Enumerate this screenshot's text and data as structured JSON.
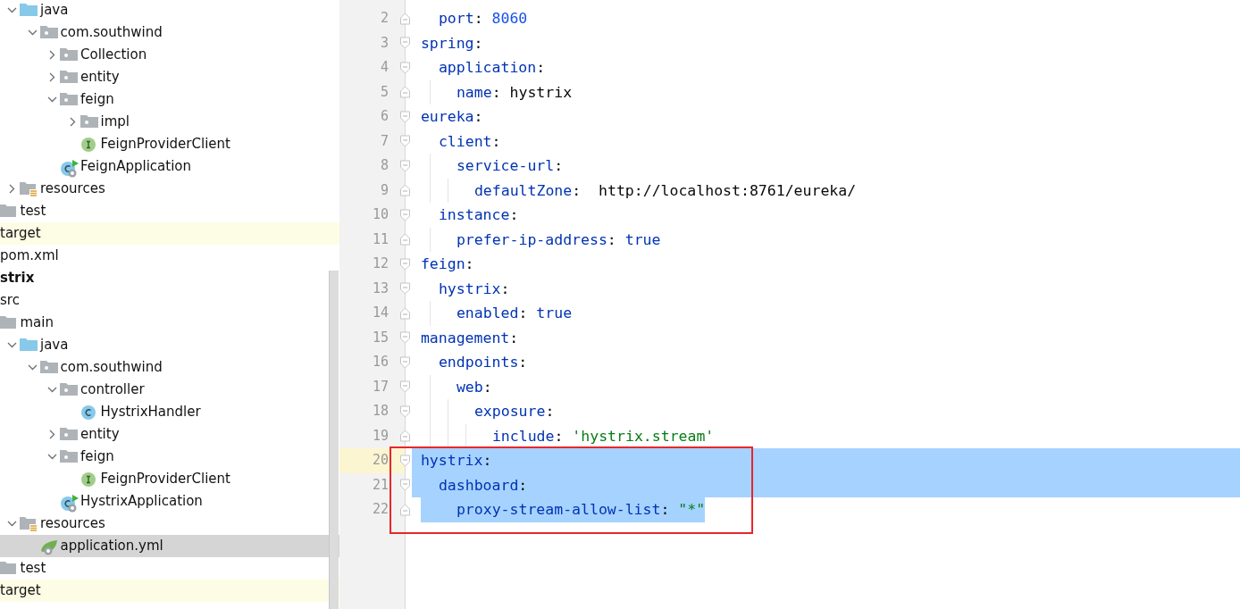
{
  "project_tree": [
    {
      "children": [
        {
          "children": [
            {
              "children": [
                {
                  "label": "java",
                  "kind": "source_root",
                  "expanded": true,
                  "selected": false,
                  "children": [
                    {
                      "label": "com.southwind",
                      "kind": "package",
                      "expanded": true,
                      "selected": false,
                      "children": [
                        {
                          "label": "Collection",
                          "kind": "package",
                          "expanded": false,
                          "selected": false
                        },
                        {
                          "label": "entity",
                          "kind": "package",
                          "expanded": false,
                          "selected": false
                        },
                        {
                          "label": "feign",
                          "kind": "package",
                          "expanded": true,
                          "selected": false,
                          "children": [
                            {
                              "label": "impl",
                              "kind": "package",
                              "expanded": false,
                              "selected": false
                            },
                            {
                              "label": "FeignProviderClient",
                              "kind": "interface",
                              "selected": false
                            }
                          ]
                        },
                        {
                          "label": "FeignApplication",
                          "kind": "app_class",
                          "selected": false
                        }
                      ]
                    }
                  ]
                },
                {
                  "label": "resources",
                  "kind": "resources",
                  "expanded": false,
                  "selected": false
                }
              ]
            },
            {
              "label": "test",
              "kind": "folder",
              "selected": false
            }
          ]
        },
        {
          "label": "target",
          "kind": "excluded",
          "selected": false
        },
        {
          "label": "pom.xml",
          "kind": "file",
          "selected": false
        }
      ]
    },
    {
      "label": "strix",
      "kind": "module",
      "selected": false,
      "children": [
        {
          "label": "src",
          "kind": "folder",
          "selected": false,
          "children": [
            {
              "label": "main",
              "kind": "folder",
              "selected": false,
              "children": [
                {
                  "label": "java",
                  "kind": "source_root",
                  "expanded": true,
                  "selected": false,
                  "children": [
                    {
                      "label": "com.southwind",
                      "kind": "package",
                      "expanded": true,
                      "selected": false,
                      "children": [
                        {
                          "label": "controller",
                          "kind": "package",
                          "expanded": true,
                          "selected": false,
                          "children": [
                            {
                              "label": "HystrixHandler",
                              "kind": "class",
                              "selected": false
                            }
                          ]
                        },
                        {
                          "label": "entity",
                          "kind": "package",
                          "expanded": false,
                          "selected": false
                        },
                        {
                          "label": "feign",
                          "kind": "package",
                          "expanded": true,
                          "selected": false,
                          "children": [
                            {
                              "label": "FeignProviderClient",
                              "kind": "interface",
                              "selected": false
                            }
                          ]
                        },
                        {
                          "label": "HystrixApplication",
                          "kind": "app_class",
                          "selected": false
                        }
                      ]
                    }
                  ]
                },
                {
                  "label": "resources",
                  "kind": "resources",
                  "expanded": true,
                  "selected": false,
                  "children": [
                    {
                      "label": "application.yml",
                      "kind": "yml",
                      "selected": true
                    }
                  ]
                }
              ]
            },
            {
              "label": "test",
              "kind": "folder",
              "selected": false
            }
          ]
        },
        {
          "label": "target",
          "kind": "excluded",
          "selected": false
        }
      ]
    }
  ],
  "editor": {
    "lines": [
      {
        "children": [
          {
            "number": "2",
            "selected": false,
            "current": false,
            "tokens": [
              {
                "kind": "key",
                "text": "port"
              },
              {
                "kind": "punct",
                "text": ": "
              },
              {
                "kind": "number",
                "text": "8060"
              }
            ]
          }
        ]
      },
      {
        "number": "3",
        "selected": false,
        "current": false,
        "tokens": [
          {
            "kind": "key",
            "text": "spring"
          },
          {
            "kind": "punct",
            "text": ":"
          }
        ],
        "children": [
          {
            "number": "4",
            "selected": false,
            "current": false,
            "tokens": [
              {
                "kind": "key",
                "text": "application"
              },
              {
                "kind": "punct",
                "text": ":"
              }
            ],
            "children": [
              {
                "number": "5",
                "selected": false,
                "current": false,
                "tokens": [
                  {
                    "kind": "key",
                    "text": "name"
                  },
                  {
                    "kind": "punct",
                    "text": ": "
                  },
                  {
                    "kind": "plain",
                    "text": "hystrix"
                  }
                ]
              }
            ]
          }
        ]
      },
      {
        "number": "6",
        "selected": false,
        "current": false,
        "tokens": [
          {
            "kind": "key",
            "text": "eureka"
          },
          {
            "kind": "punct",
            "text": ":"
          }
        ],
        "children": [
          {
            "number": "7",
            "selected": false,
            "current": false,
            "tokens": [
              {
                "kind": "key",
                "text": "client"
              },
              {
                "kind": "punct",
                "text": ":"
              }
            ],
            "children": [
              {
                "number": "8",
                "selected": false,
                "current": false,
                "tokens": [
                  {
                    "kind": "key",
                    "text": "service-url"
                  },
                  {
                    "kind": "punct",
                    "text": ":"
                  }
                ],
                "children": [
                  {
                    "number": "9",
                    "selected": false,
                    "current": false,
                    "tokens": [
                      {
                        "kind": "key",
                        "text": "defaultZone"
                      },
                      {
                        "kind": "punct",
                        "text": ":  "
                      },
                      {
                        "kind": "plain",
                        "text": "http://localhost:8761/eureka/"
                      }
                    ]
                  }
                ]
              }
            ]
          },
          {
            "number": "10",
            "selected": false,
            "current": false,
            "tokens": [
              {
                "kind": "key",
                "text": "instance"
              },
              {
                "kind": "punct",
                "text": ":"
              }
            ],
            "children": [
              {
                "number": "11",
                "selected": false,
                "current": false,
                "tokens": [
                  {
                    "kind": "key",
                    "text": "prefer-ip-address"
                  },
                  {
                    "kind": "punct",
                    "text": ": "
                  },
                  {
                    "kind": "bool",
                    "text": "true"
                  }
                ]
              }
            ]
          }
        ]
      },
      {
        "number": "12",
        "selected": false,
        "current": false,
        "tokens": [
          {
            "kind": "key",
            "text": "feign"
          },
          {
            "kind": "punct",
            "text": ":"
          }
        ],
        "children": [
          {
            "number": "13",
            "selected": false,
            "current": false,
            "tokens": [
              {
                "kind": "key",
                "text": "hystrix"
              },
              {
                "kind": "punct",
                "text": ":"
              }
            ],
            "children": [
              {
                "number": "14",
                "selected": false,
                "current": false,
                "tokens": [
                  {
                    "kind": "key",
                    "text": "enabled"
                  },
                  {
                    "kind": "punct",
                    "text": ": "
                  },
                  {
                    "kind": "bool",
                    "text": "true"
                  }
                ]
              }
            ]
          }
        ]
      },
      {
        "number": "15",
        "selected": false,
        "current": false,
        "tokens": [
          {
            "kind": "key",
            "text": "management"
          },
          {
            "kind": "punct",
            "text": ":"
          }
        ],
        "children": [
          {
            "number": "16",
            "selected": false,
            "current": false,
            "tokens": [
              {
                "kind": "key",
                "text": "endpoints"
              },
              {
                "kind": "punct",
                "text": ":"
              }
            ],
            "children": [
              {
                "number": "17",
                "selected": false,
                "current": false,
                "tokens": [
                  {
                    "kind": "key",
                    "text": "web"
                  },
                  {
                    "kind": "punct",
                    "text": ":"
                  }
                ],
                "children": [
                  {
                    "number": "18",
                    "selected": false,
                    "current": false,
                    "tokens": [
                      {
                        "kind": "key",
                        "text": "exposure"
                      },
                      {
                        "kind": "punct",
                        "text": ":"
                      }
                    ],
                    "children": [
                      {
                        "number": "19",
                        "selected": false,
                        "current": false,
                        "tokens": [
                          {
                            "kind": "key",
                            "text": "include"
                          },
                          {
                            "kind": "punct",
                            "text": ": "
                          },
                          {
                            "kind": "string",
                            "text": "'hystrix.stream'"
                          }
                        ]
                      }
                    ]
                  }
                ]
              }
            ]
          }
        ]
      },
      {
        "number": "20",
        "selected": true,
        "current": true,
        "tokens": [
          {
            "kind": "key",
            "text": "hystrix"
          },
          {
            "kind": "punct",
            "text": ":"
          }
        ],
        "children": [
          {
            "number": "21",
            "selected": true,
            "current": false,
            "tokens": [
              {
                "kind": "key",
                "text": "dashboard"
              },
              {
                "kind": "punct",
                "text": ":"
              }
            ],
            "children": [
              {
                "number": "22",
                "selected": true,
                "current": false,
                "tokens": [
                  {
                    "kind": "key",
                    "text": "proxy-stream-allow-list"
                  },
                  {
                    "kind": "punct",
                    "text": ": "
                  },
                  {
                    "kind": "string",
                    "text": "\"*\""
                  }
                ]
              }
            ]
          }
        ]
      }
    ]
  }
}
